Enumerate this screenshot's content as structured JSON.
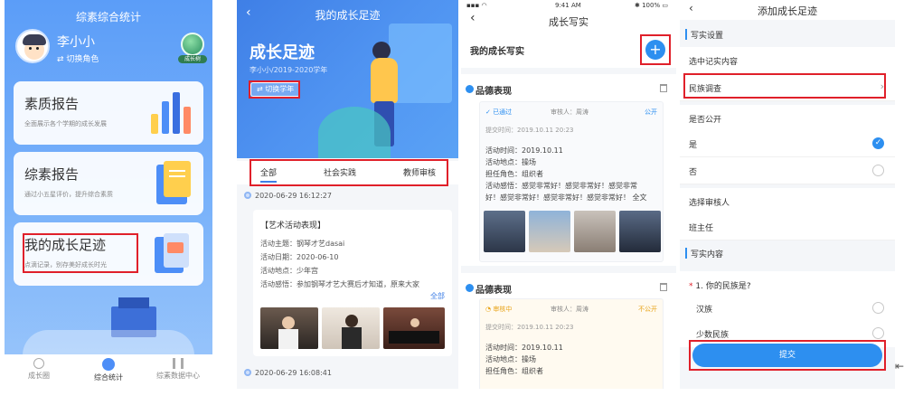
{
  "panel1": {
    "title": "综素综合统计",
    "user_name": "李小小",
    "switch_role": "⇄ 切换角色",
    "badge_label": "成长树",
    "cards": [
      {
        "title": "素质报告",
        "subtitle": "全面展示各个学期的成长发展"
      },
      {
        "title": "综素报告",
        "subtitle": "通过小五星评价，提升综合素质"
      },
      {
        "title": "我的成长足迹",
        "subtitle": "点滴记录，别存美好成长时光"
      }
    ],
    "nav": [
      "成长圈",
      "综合统计",
      "综素数据中心"
    ]
  },
  "panel2": {
    "title": "我的成长足迹",
    "big_title": "成长足迹",
    "subtitle": "李小小/2019-2020学年",
    "switch_year": "⇄ 切换学年",
    "tabs": [
      "全部",
      "社会实践",
      "教师审核"
    ],
    "entries": [
      {
        "time": "2020-06-29 16:12:27"
      },
      {
        "time": "2020-06-29 16:08:41"
      }
    ],
    "card": {
      "heading": "【艺术活动表现】",
      "lines": [
        "活动主题：钢琴才艺dasai",
        "活动日期：2020-06-10",
        "活动地点：少年宫",
        "活动感悟：参加钢琴才艺大赛后才知道，原来大家"
      ],
      "more": "全部"
    }
  },
  "panel3": {
    "status_time": "9:41 AM",
    "status_battery": "100%",
    "title": "成长写实",
    "subtitle": "我的成长写实",
    "add": "+",
    "sections": [
      {
        "title": "品德表现",
        "status": "✓ 已通过",
        "reviewer": "审核人：周涛",
        "visibility": "公开",
        "datetime": "提交时间：2019.10.11 20:23",
        "lines": [
          "活动时间：2019.10.11",
          "活动地点：操场",
          "担任角色：组织者",
          "活动感悟：感觉非常好！感觉非常好！感觉非常",
          "好！感觉非常好！感觉非常好！感觉非常好！ 全文"
        ]
      },
      {
        "title": "品德表现",
        "status": "◔ 审核中",
        "reviewer": "审核人：周涛",
        "visibility": "不公开",
        "datetime": "提交时间：2019.10.11 20:23",
        "lines": [
          "活动时间：2019.10.11",
          "活动地点：操场",
          "担任角色：组织者"
        ]
      }
    ]
  },
  "panel4": {
    "title": "添加成长足迹",
    "section1": "写实设置",
    "choose_label": "选中记实内容",
    "choose_value": "民族调查",
    "public_label": "是否公开",
    "yes": "是",
    "no": "否",
    "reviewer_label": "选择审核人",
    "reviewer_value": "班主任",
    "section2": "写实内容",
    "question_star": "*",
    "question": "1. 你的民族是?",
    "options": [
      "汉族",
      "少数民族"
    ],
    "submit": "提交"
  },
  "colors": {
    "accent": "#2d8ff0",
    "highlight": "#e0202a"
  }
}
